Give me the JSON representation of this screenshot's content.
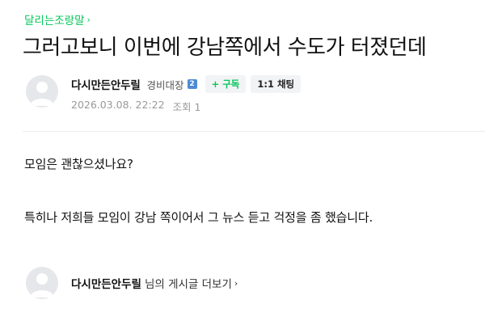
{
  "breadcrumb": {
    "label": "달리는조랑말",
    "chevron": "›"
  },
  "post": {
    "title": "그러고보니 이번에 강남쪽에서 수도가 터졌던데",
    "author": "다시만든안두릴",
    "rank": "경비대장",
    "rank_badge": "2",
    "subscribe_label": "+ 구독",
    "chat_label": "1:1 채팅",
    "date": "2026.03.08. 22:22",
    "views": "조회 1"
  },
  "content": {
    "paragraphs": [
      "모임은 괜찮으셨나요?",
      "특히나 저희들 모임이 강남 쪽이어서 그 뉴스 듣고 걱정을 좀 했습니다."
    ]
  },
  "profile_footer": {
    "name": "다시만든안두릴",
    "more_label": "님의 게시글 더보기",
    "chevron": "›"
  },
  "colors": {
    "accent": "#03c75a",
    "meta": "#999999",
    "avatar_bg": "#e6e7ea"
  },
  "icons": {
    "avatar": "default-user-avatar-icon",
    "chevron": "chevron-right-icon"
  }
}
